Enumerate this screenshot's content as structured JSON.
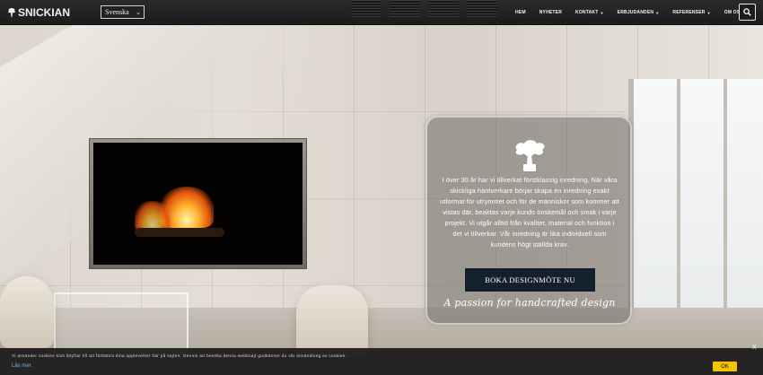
{
  "header": {
    "logo_text": "SNICKIAN",
    "language_selected": "Svenska",
    "nav": [
      {
        "label": "HEM",
        "has_dropdown": false
      },
      {
        "label": "NYHETER",
        "has_dropdown": false
      },
      {
        "label": "KONTAKT",
        "has_dropdown": true
      },
      {
        "label": "ERBJUDANDEN",
        "has_dropdown": true
      },
      {
        "label": "REFERENSER",
        "has_dropdown": true
      },
      {
        "label": "OM OSS",
        "has_dropdown": true
      }
    ],
    "search_icon": "search-icon"
  },
  "hero": {
    "panel_icon": "bonsai-tree-icon",
    "description": "I över 30 år har vi tillverkat förstklassig inredning. När våra skickliga hantverkare börjar skapa en inredning exakt utformat för utrymmet och för de människor som kommer att vistas där, beaktas varje kunds önskemål och smak i varje projekt. Vi utgår alltid från kvalitet, material och funktion i det vi tillverkar. Vår inredning är lika individuell som kundens högt ställda krav.",
    "cta_label": "BOKA DESIGNMÖTE NU",
    "tagline": "A passion for handcrafted design"
  },
  "cookie": {
    "text": "Vi använder cookies som åsyftar till att förbättra dina upplevelser här på sajten. Genom att besöka denna webbsajt godkänner du vår användning av cookies.",
    "link": "Läs mer.",
    "ok_label": "OK",
    "close_label": "X",
    "ok_color": "#f5c400"
  },
  "colors": {
    "topbar": "#1c1c1c",
    "cta_background": "#14202b"
  }
}
